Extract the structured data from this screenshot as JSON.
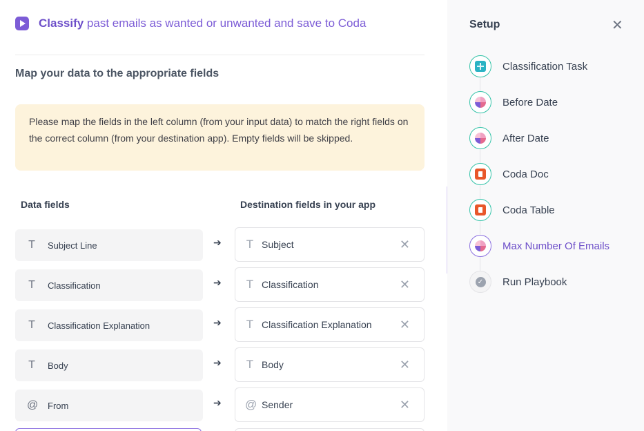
{
  "header": {
    "title_bold": "Classify",
    "title_rest": " past emails as wanted or unwanted and save to Coda",
    "icon": "play-icon"
  },
  "section": {
    "subtitle": "Map your data to the appropriate fields",
    "notice": "Please map the fields in the left column (from your input data) to match the right fields on the correct column (from your destination app). Empty fields will be skipped."
  },
  "columns": {
    "left": "Data fields",
    "right": "Destination fields in your app"
  },
  "mappings": [
    {
      "type_icon": "T",
      "source": "Subject Line",
      "arrow": "➔",
      "dest_icon": "T",
      "dest": "Subject",
      "remove": "✕"
    },
    {
      "type_icon": "T",
      "source": "Classification",
      "arrow": "➔",
      "dest_icon": "T",
      "dest": "Classification",
      "remove": "✕"
    },
    {
      "type_icon": "T",
      "source": "Classification Explanation",
      "arrow": "➔",
      "dest_icon": "T",
      "dest": "Classification Explanation",
      "remove": "✕"
    },
    {
      "type_icon": "T",
      "source": "Body",
      "arrow": "➔",
      "dest_icon": "T",
      "dest": "Body",
      "remove": "✕"
    },
    {
      "type_icon": "@",
      "source": "From",
      "arrow": "➔",
      "dest_icon": "@",
      "dest": "Sender",
      "remove": "✕"
    }
  ],
  "sidebar": {
    "title": "Setup",
    "close": "✕",
    "steps": [
      {
        "label": "Classification Task",
        "icon": "grid-icon",
        "state": "done"
      },
      {
        "label": "Before Date",
        "icon": "blob-icon",
        "state": "done"
      },
      {
        "label": "After Date",
        "icon": "blob-icon",
        "state": "done"
      },
      {
        "label": "Coda Doc",
        "icon": "coda-icon",
        "state": "done"
      },
      {
        "label": "Coda Table",
        "icon": "coda-icon",
        "state": "done"
      },
      {
        "label": "Max Number Of Emails",
        "icon": "blob-icon",
        "state": "current"
      },
      {
        "label": "Run Playbook",
        "icon": "check-icon",
        "state": "pending",
        "check": "✓"
      }
    ]
  },
  "colors": {
    "accent": "#7c5cd6",
    "done_ring": "#34c3a8",
    "notice_bg": "#fdf3dc",
    "coda": "#e8572a"
  }
}
